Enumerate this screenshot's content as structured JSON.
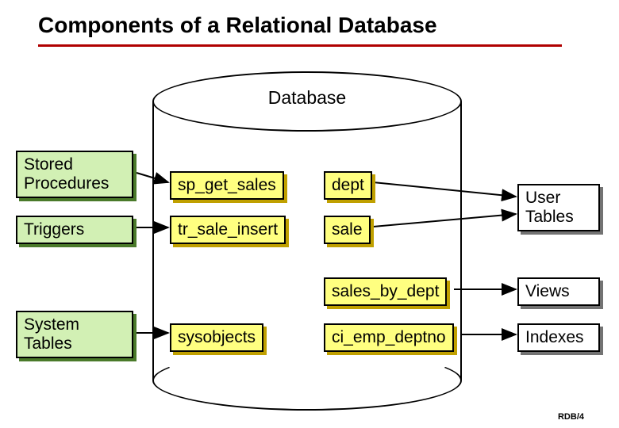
{
  "title": "Components of a Relational Database",
  "db_label": "Database",
  "left": {
    "stored_procedures": "Stored\nProcedures",
    "triggers": "Triggers",
    "system_tables": "System\nTables"
  },
  "inner": {
    "sp_get_sales": "sp_get_sales",
    "tr_sale_insert": "tr_sale_insert",
    "sysobjects": "sysobjects",
    "dept": "dept",
    "sale": "sale",
    "sales_by_dept": "sales_by_dept",
    "ci_emp_deptno": "ci_emp_deptno"
  },
  "right": {
    "user_tables": "User\nTables",
    "views": "Views",
    "indexes": "Indexes"
  },
  "footer": "RDB/4"
}
